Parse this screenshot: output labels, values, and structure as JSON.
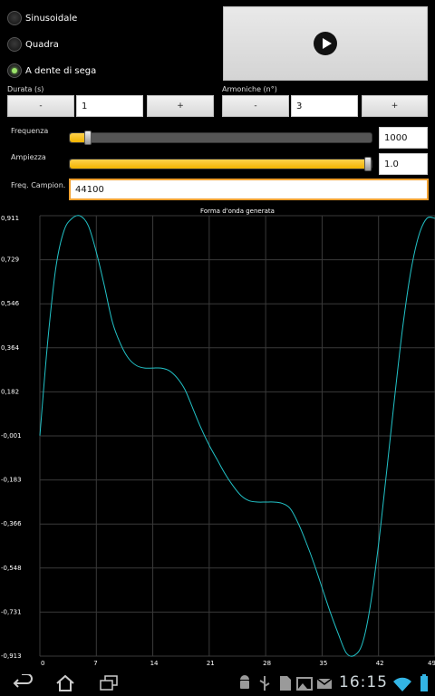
{
  "waveforms": [
    {
      "label": "Sinusoidale",
      "checked": false
    },
    {
      "label": "Quadra",
      "checked": false
    },
    {
      "label": "A dente di sega",
      "checked": true
    }
  ],
  "durata": {
    "label": "Durata (s)",
    "minus": "-",
    "value": "1",
    "plus": "+"
  },
  "armoniche": {
    "label": "Armoniche (n°)",
    "minus": "-",
    "value": "3",
    "plus": "+"
  },
  "frequenza": {
    "label": "Frequenza",
    "value": "1000",
    "level": 0.05
  },
  "ampiezza": {
    "label": "Ampiezza",
    "value": "1.0",
    "level": 1.0
  },
  "campion": {
    "label": "Freq. Campion.",
    "value": "44100"
  },
  "status": {
    "time": "16:15"
  },
  "colors": {
    "accent": "#f2b300",
    "line": "#22c3c8",
    "grid": "#3a3a3a"
  },
  "chart_data": {
    "type": "line",
    "title": "Forma d'onda generata",
    "x_ticks": [
      "0",
      "7",
      "14",
      "21",
      "28",
      "35",
      "42",
      "49"
    ],
    "y_ticks": [
      "0,911",
      "0,729",
      "0,546",
      "0,364",
      "0,182",
      "-0,001",
      "-0,183",
      "-0,366",
      "-0,548",
      "-0,731",
      "-0,913"
    ],
    "xlim": [
      0,
      49
    ],
    "ylim": [
      -0.913,
      0.911
    ],
    "grid": true,
    "x": [
      0,
      1,
      2,
      3,
      4,
      5,
      6,
      7,
      8,
      9,
      10,
      11,
      12,
      13,
      14,
      15,
      16,
      17,
      18,
      19,
      20,
      21,
      22,
      23,
      24,
      25,
      26,
      27,
      28,
      29,
      30,
      31,
      32,
      33,
      34,
      35,
      36,
      37,
      38,
      39,
      40,
      41,
      42,
      43,
      44,
      45,
      46,
      47,
      48,
      49
    ],
    "y": [
      0.0,
      0.4,
      0.7,
      0.85,
      0.9,
      0.91,
      0.87,
      0.76,
      0.62,
      0.47,
      0.38,
      0.32,
      0.29,
      0.28,
      0.28,
      0.28,
      0.27,
      0.24,
      0.19,
      0.11,
      0.03,
      -0.04,
      -0.1,
      -0.16,
      -0.21,
      -0.25,
      -0.27,
      -0.275,
      -0.275,
      -0.275,
      -0.28,
      -0.3,
      -0.36,
      -0.44,
      -0.53,
      -0.63,
      -0.73,
      -0.82,
      -0.9,
      -0.91,
      -0.86,
      -0.7,
      -0.45,
      -0.15,
      0.16,
      0.45,
      0.68,
      0.83,
      0.9,
      0.9
    ]
  }
}
